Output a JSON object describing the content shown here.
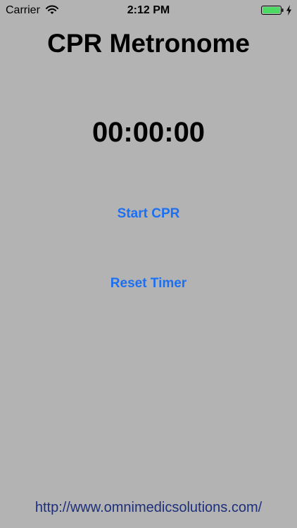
{
  "status_bar": {
    "carrier": "Carrier",
    "time": "2:12 PM",
    "battery_color": "#4cd964",
    "icons": [
      "wifi-icon",
      "battery-icon",
      "charging-bolt-icon"
    ]
  },
  "app": {
    "title": "CPR Metronome",
    "timer": "00:00:00",
    "start_button": "Start CPR",
    "reset_button": "Reset Timer",
    "footer_link": "http://www.omnimedicsolutions.com/",
    "accent_color": "#1d6ff2",
    "background_color": "#b3b3b3"
  }
}
